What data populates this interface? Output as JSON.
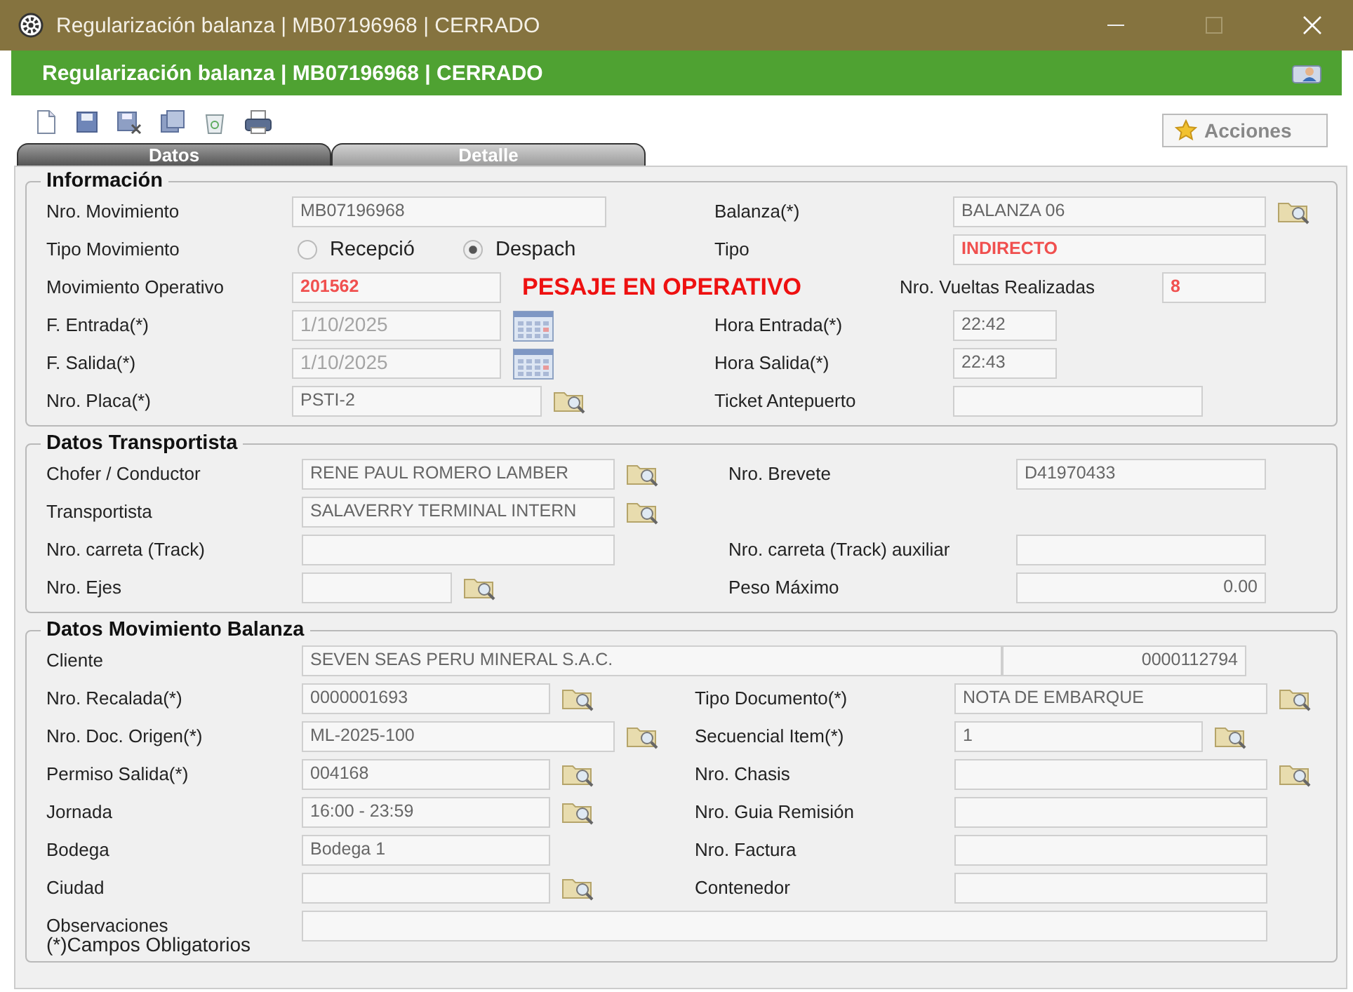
{
  "window": {
    "title": "Regularización balanza | MB07196968 | CERRADO"
  },
  "header": {
    "title": "Regularización balanza | MB07196968 | CERRADO"
  },
  "toolbar": {
    "actions_button": "Acciones"
  },
  "tabs": [
    {
      "label": "Datos",
      "selected": true
    },
    {
      "label": "Detalle",
      "selected": false
    }
  ],
  "sections": [
    {
      "title": "Información",
      "rows": [
        {
          "left": {
            "label": "Nro. Movimiento",
            "kind": "text",
            "value": "MB07196968"
          },
          "right": {
            "label": "Balanza(*)",
            "kind": "text",
            "value": "BALANZA 06",
            "lookup": true
          }
        },
        {
          "left": {
            "label": "Tipo Movimiento",
            "kind": "radio",
            "options": [
              {
                "label": "Recepció",
                "selected": false
              },
              {
                "label": "Despach",
                "selected": true
              }
            ]
          },
          "right": {
            "label": "Tipo",
            "kind": "text",
            "value": "INDIRECTO",
            "alert": true
          }
        },
        {
          "left": {
            "label": "Movimiento Operativo",
            "kind": "text",
            "value": "201562",
            "alert": true
          },
          "note": "PESAJE EN OPERATIVO",
          "right": {
            "label": "Nro. Vueltas Realizadas",
            "kind": "text",
            "value": "8",
            "alert": true
          }
        },
        {
          "left": {
            "label": "F. Entrada(*)",
            "kind": "text",
            "value": "1/10/2025",
            "disabled": true,
            "calendar": true
          },
          "right": {
            "label": "Hora Entrada(*)",
            "kind": "text",
            "value": "22:42"
          }
        },
        {
          "left": {
            "label": "F. Salida(*)",
            "kind": "text",
            "value": "1/10/2025",
            "disabled": true,
            "calendar": true
          },
          "right": {
            "label": "Hora Salida(*)",
            "kind": "text",
            "value": "22:43"
          }
        },
        {
          "left": {
            "label": "Nro. Placa(*)",
            "kind": "text",
            "value": "PSTI-2",
            "lookup": true
          },
          "right": {
            "label": "Ticket Antepuerto",
            "kind": "text"
          }
        }
      ]
    },
    {
      "title": "Datos Transportista",
      "rows": [
        {
          "left": {
            "label": "Chofer / Conductor",
            "kind": "text",
            "value": "RENE PAUL ROMERO LAMBER",
            "lookup": true
          },
          "right": {
            "label": "Nro. Brevete",
            "kind": "text",
            "value": "D41970433"
          }
        },
        {
          "left": {
            "label": "Transportista",
            "kind": "text",
            "value": "SALAVERRY TERMINAL INTERN",
            "lookup": true
          }
        },
        {
          "left": {
            "label": "Nro. carreta (Track)",
            "kind": "text"
          },
          "right": {
            "label": "Nro. carreta (Track) auxiliar",
            "kind": "text"
          }
        },
        {
          "left": {
            "label": "Nro. Ejes",
            "kind": "text",
            "lookup": true
          },
          "right": {
            "label": "Peso Máximo",
            "kind": "number",
            "value": "0.00"
          }
        }
      ]
    },
    {
      "title": "Datos Movimiento Balanza",
      "rows": [
        {
          "left": {
            "label": "Cliente",
            "kind": "text",
            "value": "SEVEN SEAS PERU MINERAL S.A.C."
          },
          "right": {
            "kind": "number",
            "value": "0000112794"
          }
        },
        {
          "left": {
            "label": "Nro. Recalada(*)",
            "kind": "text",
            "value": "0000001693",
            "lookup": true
          },
          "right": {
            "label": "Tipo Documento(*)",
            "kind": "text",
            "value": "NOTA DE EMBARQUE",
            "lookup": true
          }
        },
        {
          "left": {
            "label": "Nro. Doc. Origen(*)",
            "kind": "text",
            "value": "ML-2025-100",
            "lookup": true
          },
          "right": {
            "label": "Secuencial Item(*)",
            "kind": "text",
            "value": "1",
            "lookup": true
          }
        },
        {
          "left": {
            "label": "Permiso Salida(*)",
            "kind": "text",
            "value": "004168",
            "lookup": true
          },
          "right": {
            "label": "Nro. Chasis",
            "kind": "text",
            "lookup": true
          }
        },
        {
          "left": {
            "label": "Jornada",
            "kind": "text",
            "value": "16:00 - 23:59",
            "lookup": true
          },
          "right": {
            "label": "Nro. Guia Remisión",
            "kind": "text"
          }
        },
        {
          "left": {
            "label": "Bodega",
            "kind": "text",
            "value": "Bodega 1"
          },
          "right": {
            "label": "Nro. Factura",
            "kind": "text"
          }
        },
        {
          "left": {
            "label": "Ciudad",
            "kind": "text",
            "lookup": true
          },
          "right": {
            "label": "Contenedor",
            "kind": "text"
          }
        },
        {
          "left": {
            "label": "Observaciones",
            "kind": "text"
          }
        }
      ],
      "footnote": "(*)Campos Obligatorios"
    }
  ]
}
